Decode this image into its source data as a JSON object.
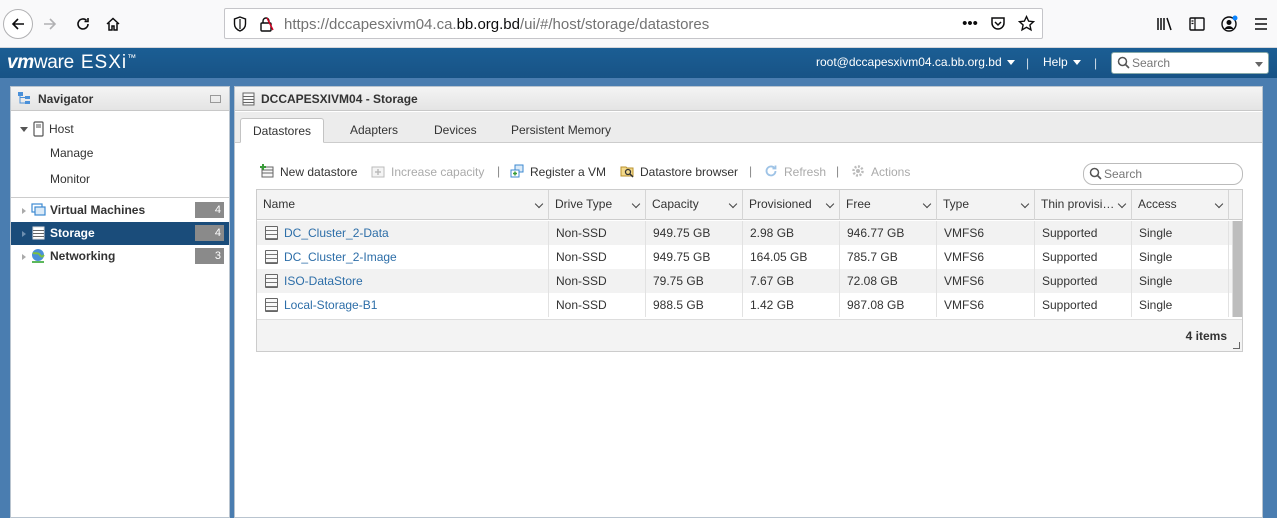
{
  "browser": {
    "url_prefix": "https://dccapesxivm04.ca.",
    "url_domain": "bb.org.bd",
    "url_suffix": "/ui/#/host/storage/datastores",
    "url_more": "•••"
  },
  "header": {
    "logo_vm": "vm",
    "logo_ware": "ware",
    "logo_product": "ESXi",
    "logo_tm": "™",
    "user": "root@dccapesxivm04.ca.bb.org.bd",
    "help": "Help",
    "separator": "|",
    "search_placeholder": "Search"
  },
  "navigator": {
    "title": "Navigator",
    "host_label": "Host",
    "host_children": [
      "Manage",
      "Monitor"
    ],
    "items": [
      {
        "label": "Virtual Machines",
        "count": "4"
      },
      {
        "label": "Storage",
        "count": "4"
      },
      {
        "label": "Networking",
        "count": "3"
      }
    ]
  },
  "main": {
    "title": "DCCAPESXIVM04 - Storage",
    "tabs": [
      "Datastores",
      "Adapters",
      "Devices",
      "Persistent Memory"
    ],
    "active_tab": "Datastores",
    "toolbar": {
      "new_datastore": "New datastore",
      "increase_capacity": "Increase capacity",
      "register_vm": "Register a VM",
      "datastore_browser": "Datastore browser",
      "refresh": "Refresh",
      "actions": "Actions",
      "separator": "|",
      "search_placeholder": "Search"
    },
    "grid": {
      "columns": [
        "Name",
        "Drive Type",
        "Capacity",
        "Provisioned",
        "Free",
        "Type",
        "Thin provisi…",
        "Access"
      ],
      "rows": [
        [
          "DC_Cluster_2-Data",
          "Non-SSD",
          "949.75 GB",
          "2.98 GB",
          "946.77 GB",
          "VMFS6",
          "Supported",
          "Single"
        ],
        [
          "DC_Cluster_2-Image",
          "Non-SSD",
          "949.75 GB",
          "164.05 GB",
          "785.7 GB",
          "VMFS6",
          "Supported",
          "Single"
        ],
        [
          "ISO-DataStore",
          "Non-SSD",
          "79.75 GB",
          "7.67 GB",
          "72.08 GB",
          "VMFS6",
          "Supported",
          "Single"
        ],
        [
          "Local-Storage-B1",
          "Non-SSD",
          "988.5 GB",
          "1.42 GB",
          "987.08 GB",
          "VMFS6",
          "Supported",
          "Single"
        ]
      ],
      "footer": "4 items"
    }
  },
  "colors": {
    "header_bg": "#185386",
    "app_bg": "#4a7db0",
    "nav_active": "#1a4c7a",
    "link": "#2d6ea8"
  }
}
